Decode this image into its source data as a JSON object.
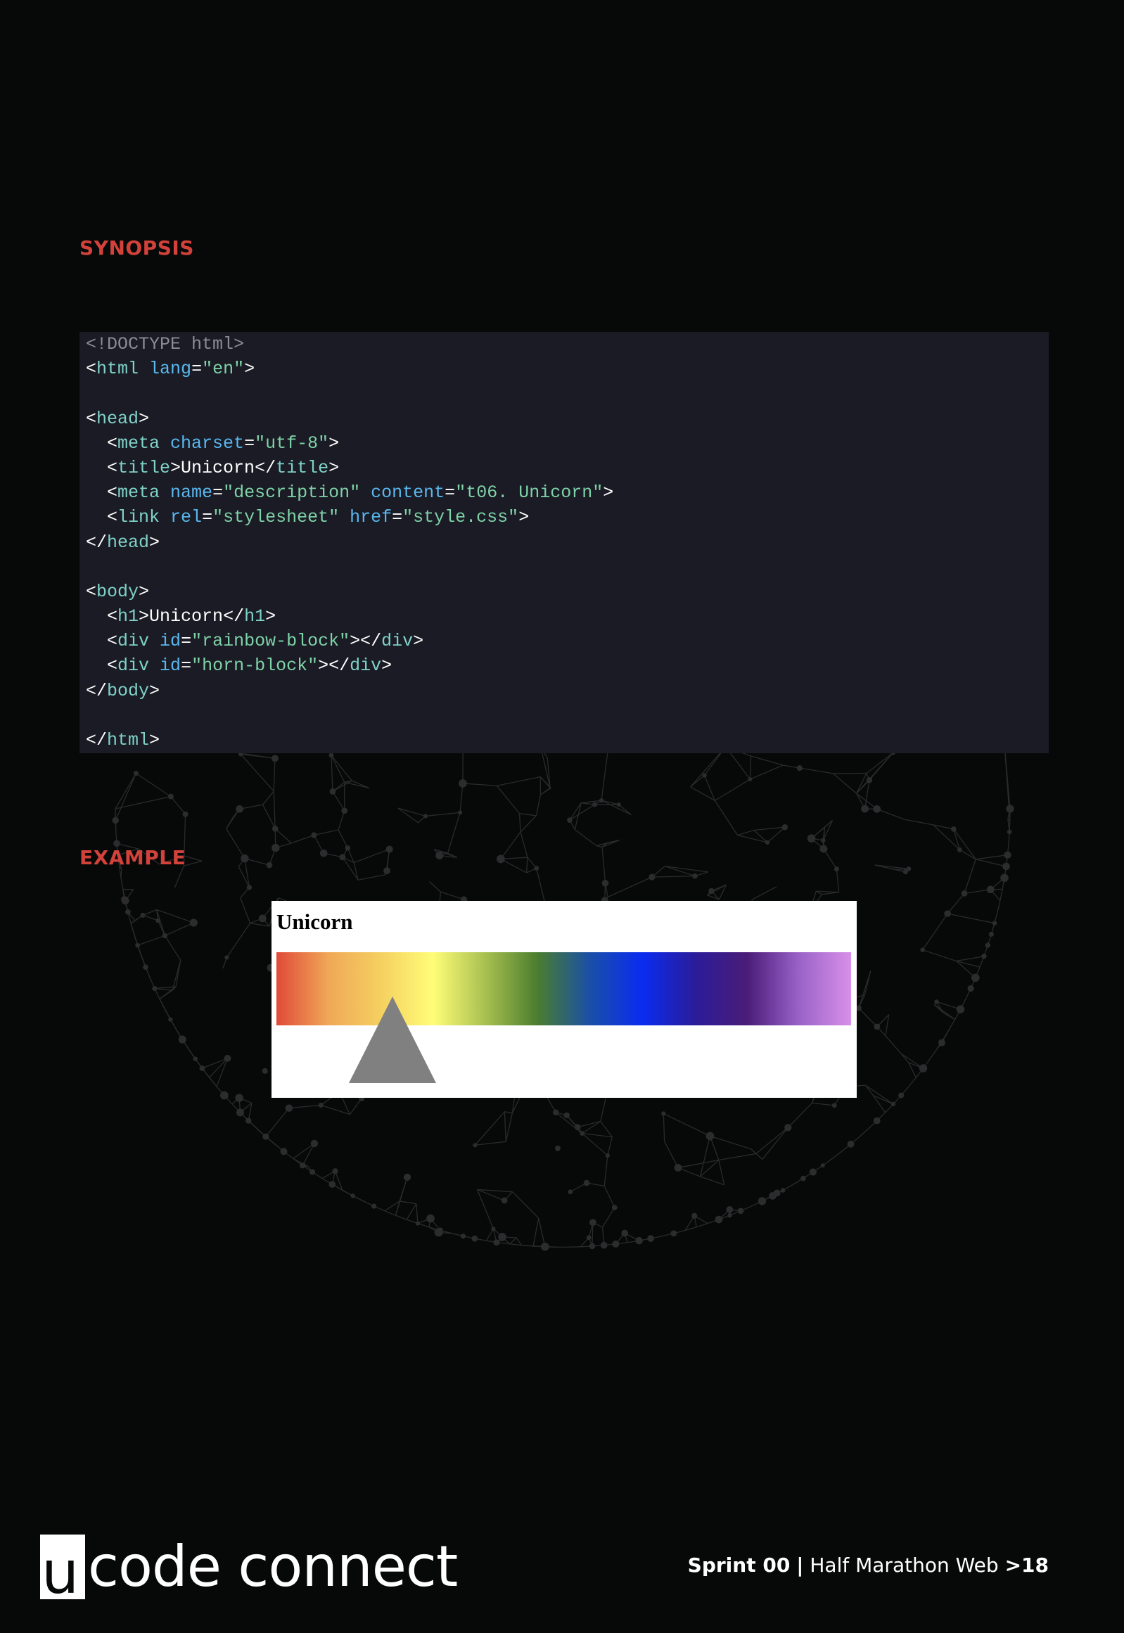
{
  "synopsis": {
    "title": "SYNOPSIS",
    "code_lines": [
      [
        {
          "t": "<!DOCTYPE html>",
          "c": "doc"
        }
      ],
      [
        {
          "t": "<",
          "c": "punc"
        },
        {
          "t": "html",
          "c": "tag"
        },
        {
          "t": " ",
          "c": "punc"
        },
        {
          "t": "lang",
          "c": "attr"
        },
        {
          "t": "=",
          "c": "punc"
        },
        {
          "t": "\"en\"",
          "c": "val"
        },
        {
          "t": ">",
          "c": "punc"
        }
      ],
      [],
      [
        {
          "t": "<",
          "c": "punc"
        },
        {
          "t": "head",
          "c": "tag"
        },
        {
          "t": ">",
          "c": "punc"
        }
      ],
      [
        {
          "t": "  <",
          "c": "punc"
        },
        {
          "t": "meta",
          "c": "tag"
        },
        {
          "t": " ",
          "c": "punc"
        },
        {
          "t": "charset",
          "c": "attr"
        },
        {
          "t": "=",
          "c": "punc"
        },
        {
          "t": "\"utf-8\"",
          "c": "val"
        },
        {
          "t": ">",
          "c": "punc"
        }
      ],
      [
        {
          "t": "  <",
          "c": "punc"
        },
        {
          "t": "title",
          "c": "tag"
        },
        {
          "t": ">",
          "c": "punc"
        },
        {
          "t": "Unicorn",
          "c": "text"
        },
        {
          "t": "</",
          "c": "punc"
        },
        {
          "t": "title",
          "c": "tag"
        },
        {
          "t": ">",
          "c": "punc"
        }
      ],
      [
        {
          "t": "  <",
          "c": "punc"
        },
        {
          "t": "meta",
          "c": "tag"
        },
        {
          "t": " ",
          "c": "punc"
        },
        {
          "t": "name",
          "c": "attr"
        },
        {
          "t": "=",
          "c": "punc"
        },
        {
          "t": "\"description\"",
          "c": "val"
        },
        {
          "t": " ",
          "c": "punc"
        },
        {
          "t": "content",
          "c": "attr"
        },
        {
          "t": "=",
          "c": "punc"
        },
        {
          "t": "\"t06. Unicorn\"",
          "c": "val"
        },
        {
          "t": ">",
          "c": "punc"
        }
      ],
      [
        {
          "t": "  <",
          "c": "punc"
        },
        {
          "t": "link",
          "c": "tag"
        },
        {
          "t": " ",
          "c": "punc"
        },
        {
          "t": "rel",
          "c": "attr"
        },
        {
          "t": "=",
          "c": "punc"
        },
        {
          "t": "\"stylesheet\"",
          "c": "val"
        },
        {
          "t": " ",
          "c": "punc"
        },
        {
          "t": "href",
          "c": "attr"
        },
        {
          "t": "=",
          "c": "punc"
        },
        {
          "t": "\"style.css\"",
          "c": "val"
        },
        {
          "t": ">",
          "c": "punc"
        }
      ],
      [
        {
          "t": "</",
          "c": "punc"
        },
        {
          "t": "head",
          "c": "tag"
        },
        {
          "t": ">",
          "c": "punc"
        }
      ],
      [],
      [
        {
          "t": "<",
          "c": "punc"
        },
        {
          "t": "body",
          "c": "tag"
        },
        {
          "t": ">",
          "c": "punc"
        }
      ],
      [
        {
          "t": "  <",
          "c": "punc"
        },
        {
          "t": "h1",
          "c": "tag"
        },
        {
          "t": ">",
          "c": "punc"
        },
        {
          "t": "Unicorn",
          "c": "text"
        },
        {
          "t": "</",
          "c": "punc"
        },
        {
          "t": "h1",
          "c": "tag"
        },
        {
          "t": ">",
          "c": "punc"
        }
      ],
      [
        {
          "t": "  <",
          "c": "punc"
        },
        {
          "t": "div",
          "c": "tag"
        },
        {
          "t": " ",
          "c": "punc"
        },
        {
          "t": "id",
          "c": "attr"
        },
        {
          "t": "=",
          "c": "punc"
        },
        {
          "t": "\"rainbow-block\"",
          "c": "val"
        },
        {
          "t": "></",
          "c": "punc"
        },
        {
          "t": "div",
          "c": "tag"
        },
        {
          "t": ">",
          "c": "punc"
        }
      ],
      [
        {
          "t": "  <",
          "c": "punc"
        },
        {
          "t": "div",
          "c": "tag"
        },
        {
          "t": " ",
          "c": "punc"
        },
        {
          "t": "id",
          "c": "attr"
        },
        {
          "t": "=",
          "c": "punc"
        },
        {
          "t": "\"horn-block\"",
          "c": "val"
        },
        {
          "t": "></",
          "c": "punc"
        },
        {
          "t": "div",
          "c": "tag"
        },
        {
          "t": ">",
          "c": "punc"
        }
      ],
      [
        {
          "t": "</",
          "c": "punc"
        },
        {
          "t": "body",
          "c": "tag"
        },
        {
          "t": ">",
          "c": "punc"
        }
      ],
      [],
      [
        {
          "t": "</",
          "c": "punc"
        },
        {
          "t": "html",
          "c": "tag"
        },
        {
          "t": ">",
          "c": "punc"
        }
      ]
    ]
  },
  "example": {
    "title": "EXAMPLE",
    "heading": "Unicorn",
    "rainbow_colors": [
      "#e04a38",
      "#f0a858",
      "#f5d060",
      "#fffd78",
      "#a8c050",
      "#4a7d2e",
      "#1a4fa8",
      "#0a2cf0",
      "#2a1c9a",
      "#4a1c78",
      "#9a62c8",
      "#d890e8"
    ],
    "horn_color": "#808080"
  },
  "footer": {
    "logo_letter": "u",
    "logo_text": "code connect",
    "sprint": "Sprint 00",
    "separator": "|",
    "course": "Half Marathon Web",
    "page_prefix": ">",
    "page_number": "18"
  },
  "colors": {
    "background": "#070808",
    "accent": "#d2423a",
    "code_background": "#1a1b24"
  }
}
